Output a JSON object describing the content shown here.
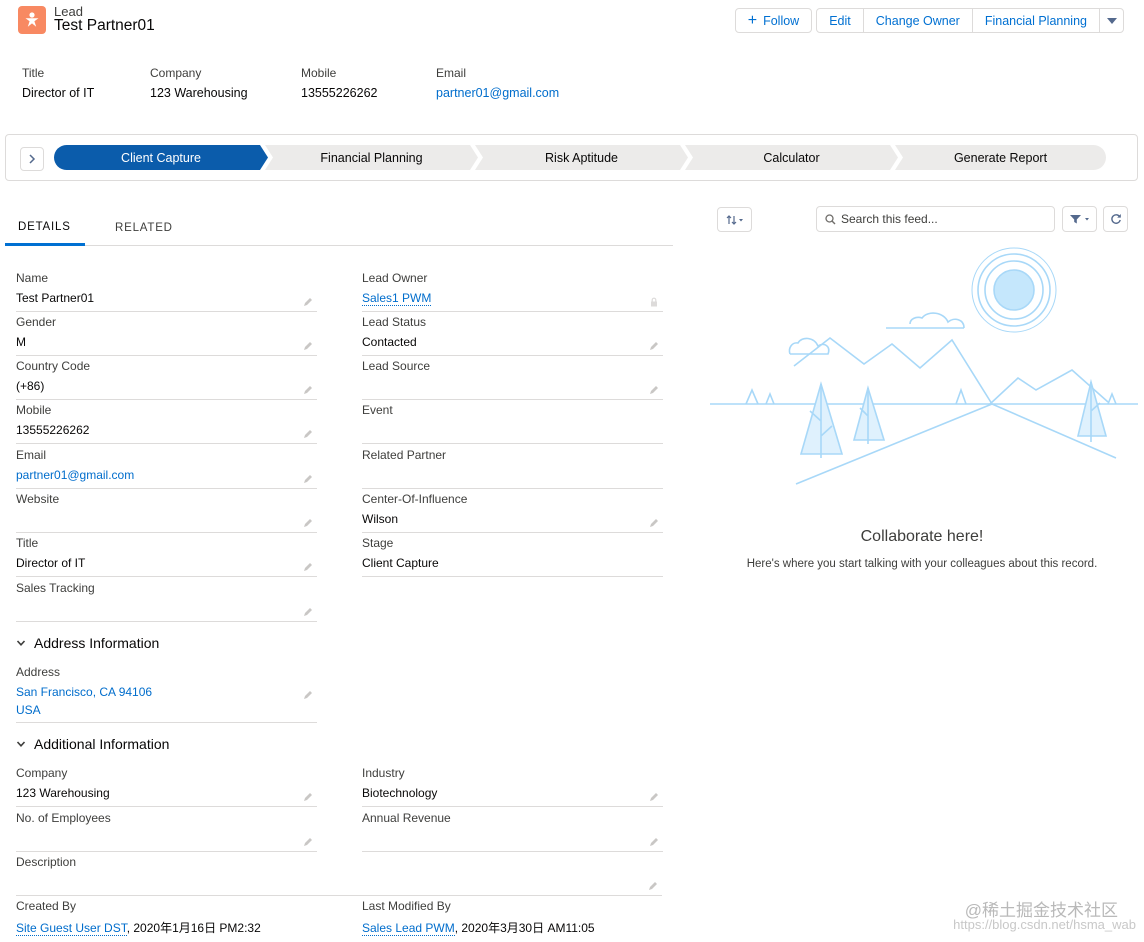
{
  "header": {
    "object_label": "Lead",
    "record_title": "Test Partner01",
    "actions": {
      "follow": "Follow",
      "edit": "Edit",
      "change_owner": "Change Owner",
      "financial_planning": "Financial Planning"
    },
    "highlights": [
      {
        "label": "Title",
        "value": "Director of IT"
      },
      {
        "label": "Company",
        "value": "123 Warehousing"
      },
      {
        "label": "Mobile",
        "value": "13555226262"
      },
      {
        "label": "Email",
        "value": "partner01@gmail.com"
      }
    ]
  },
  "path": {
    "stages": [
      "Client Capture",
      "Financial Planning",
      "Risk Aptitude",
      "Calculator",
      "Generate Report"
    ],
    "active_stage": "Client Capture",
    "active_color": "#0b5cab"
  },
  "tabs": [
    "DETAILS",
    "RELATED"
  ],
  "details": {
    "left": [
      {
        "label": "Name",
        "value": "Test Partner01"
      },
      {
        "label": "Gender",
        "value": "M"
      },
      {
        "label": "Country Code",
        "value": "(+86)"
      },
      {
        "label": "Mobile",
        "value": "13555226262"
      },
      {
        "label": "Email",
        "value": "partner01@gmail.com"
      },
      {
        "label": "Website",
        "value": ""
      },
      {
        "label": "Title",
        "value": "Director of IT"
      },
      {
        "label": "Sales Tracking",
        "value": ""
      }
    ],
    "right": [
      {
        "label": "Lead Owner",
        "value": "Sales1 PWM"
      },
      {
        "label": "Lead Status",
        "value": "Contacted"
      },
      {
        "label": "Lead Source",
        "value": ""
      },
      {
        "label": "Event",
        "value": ""
      },
      {
        "label": "Related Partner",
        "value": ""
      },
      {
        "label": "Center-Of-Influence",
        "value": "Wilson"
      },
      {
        "label": "Stage",
        "value": "Client Capture"
      }
    ]
  },
  "address_section": {
    "title": "Address Information",
    "address_label": "Address",
    "address_line1": "San Francisco, CA 94106",
    "address_line2": "USA"
  },
  "additional_section": {
    "title": "Additional Information",
    "company_label": "Company",
    "company_value": "123 Warehousing",
    "industry_label": "Industry",
    "industry_value": "Biotechnology",
    "employees_label": "No. of Employees",
    "employees_value": "",
    "revenue_label": "Annual Revenue",
    "revenue_value": "",
    "description_label": "Description",
    "description_value": "",
    "created_by_label": "Created By",
    "created_by_user": "Site Guest User DST",
    "created_by_date": ", 2020年1月16日 PM2:32",
    "modified_by_label": "Last Modified By",
    "modified_by_user": "Sales Lead PWM",
    "modified_by_date": ", 2020年3月30日 AM11:05"
  },
  "feed": {
    "search_placeholder": "Search this feed...",
    "empty_title": "Collaborate here!",
    "empty_subtitle": "Here's where you start talking with your colleagues about this record."
  },
  "watermark": {
    "line1": "@稀土掘金技术社区",
    "line2": "https://blog.csdn.net/hsma_wab"
  },
  "colors": {
    "brand": "#0070d2",
    "link": "#006dcc",
    "lead_icon": "#f88962",
    "illustration": "#b8e1fa"
  },
  "icons": [
    "lead-icon",
    "plus-icon",
    "caret-down-icon",
    "chevron-right-icon",
    "pencil-icon",
    "lock-icon",
    "chevron-down-icon",
    "sort-icon",
    "search-icon",
    "filter-icon",
    "refresh-icon"
  ]
}
